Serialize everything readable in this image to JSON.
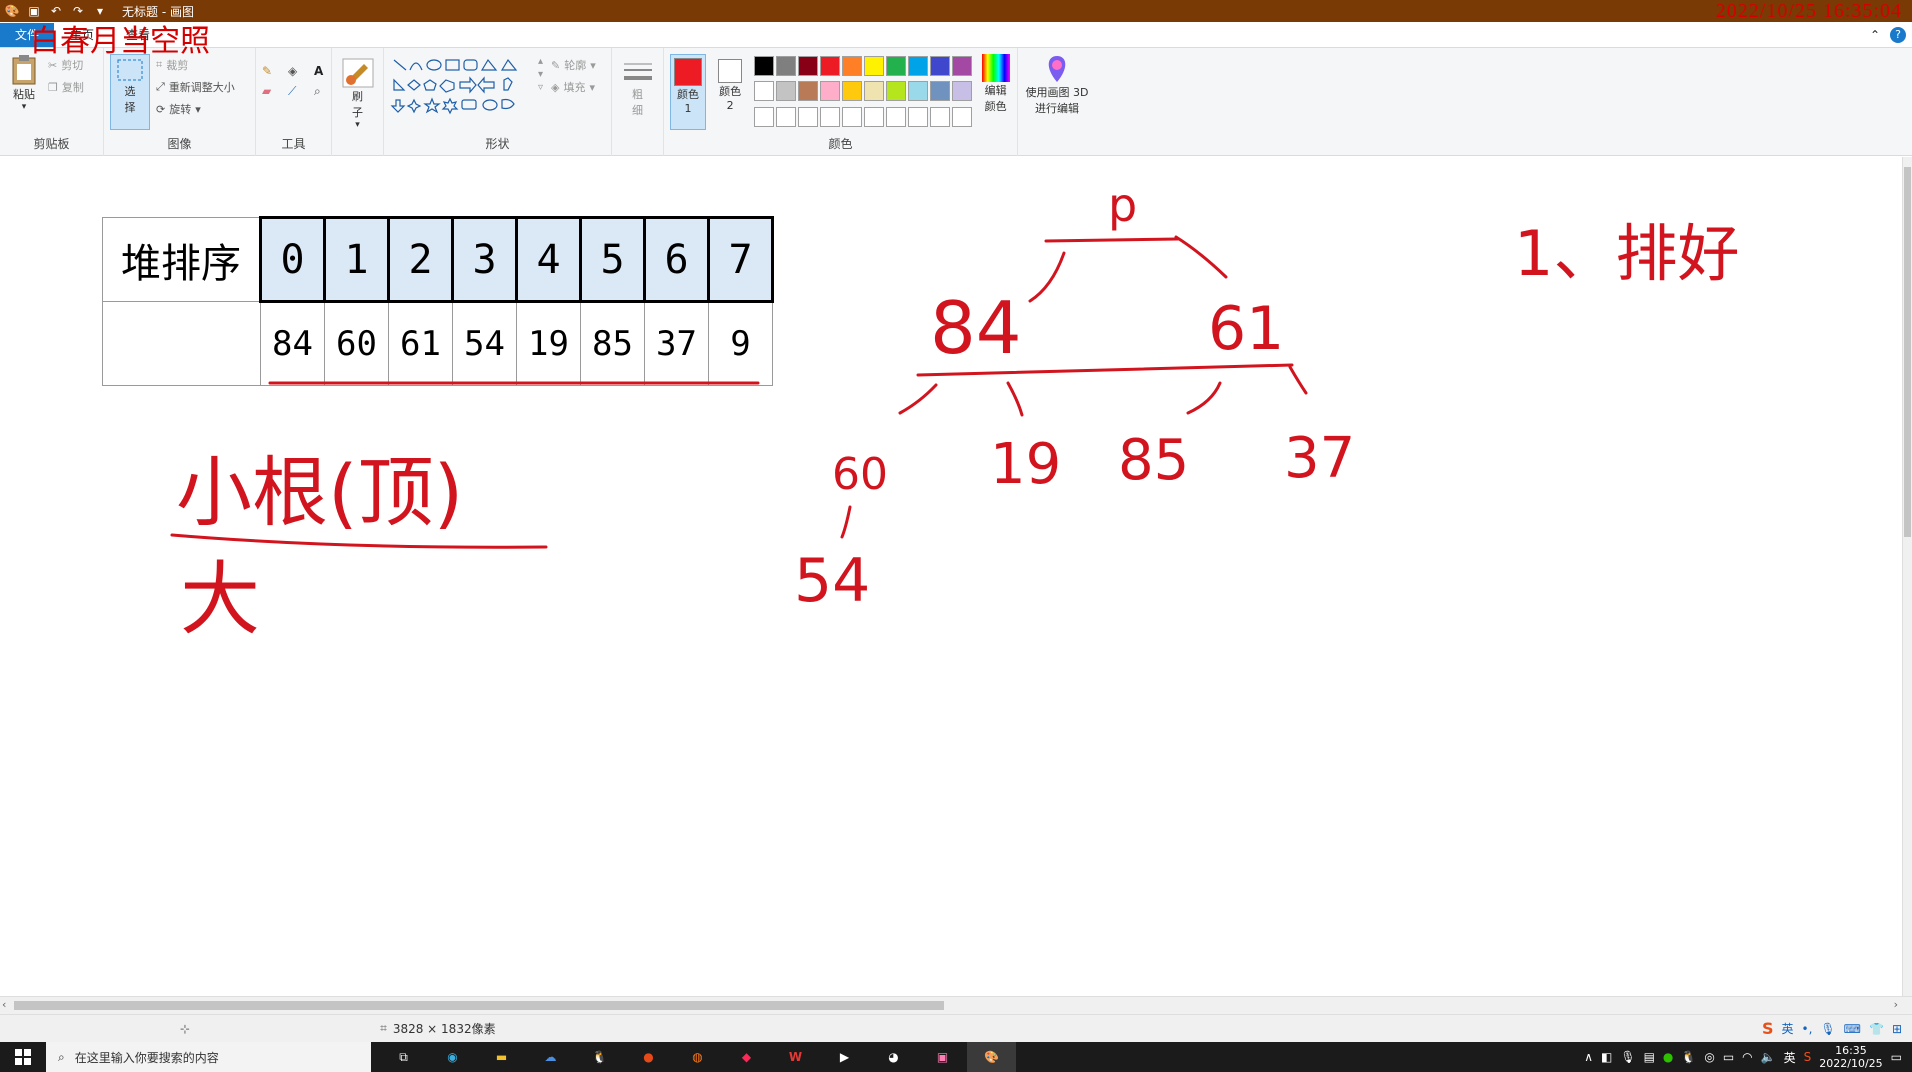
{
  "window": {
    "title": "无标题 - 画图",
    "watermark": "白春月当空照",
    "timestamp_overlay": "2022/10/25 16:35:04"
  },
  "tabs": {
    "file": "文件",
    "home": "主页",
    "view": "查看"
  },
  "ribbon": {
    "clipboard": {
      "paste": "粘贴",
      "cut": "剪切",
      "copy": "复制",
      "group": "剪贴板"
    },
    "image": {
      "select": "选择",
      "crop": "裁剪",
      "resize": "重新调整大小",
      "rotate": "旋转",
      "group": "图像"
    },
    "tools": {
      "group": "工具"
    },
    "brushes": {
      "label": "刷子"
    },
    "shapes": {
      "outline": "轮廓",
      "fill": "填充",
      "group": "形状"
    },
    "size": {
      "label": "粗细"
    },
    "colors": {
      "color1": "颜色 1",
      "color2": "颜色 2",
      "edit": "编辑颜色",
      "paint3d": "使用画图 3D 进行编辑",
      "group": "颜色",
      "color1_value": "#ed1c24",
      "color2_value": "#ffffff",
      "palette": [
        "#000000",
        "#7f7f7f",
        "#880015",
        "#ed1c24",
        "#ff7f27",
        "#fff200",
        "#22b14c",
        "#00a2e8",
        "#3f48cc",
        "#a349a4",
        "#ffffff",
        "#c3c3c3",
        "#b97a57",
        "#ffaec9",
        "#ffc90e",
        "#efe4b0",
        "#b5e61d",
        "#99d9ea",
        "#7092be",
        "#c8bfe7",
        "#ffffff",
        "#ffffff",
        "#ffffff",
        "#ffffff",
        "#ffffff",
        "#ffffff",
        "#ffffff",
        "#ffffff",
        "#ffffff",
        "#ffffff"
      ]
    }
  },
  "canvas": {
    "table": {
      "label": "堆排序",
      "indices": [
        "0",
        "1",
        "2",
        "3",
        "4",
        "5",
        "6",
        "7"
      ],
      "values": [
        "84",
        "60",
        "61",
        "54",
        "19",
        "85",
        "37",
        "9"
      ]
    },
    "annotations": {
      "small_root": "小根(顶)",
      "big": "大",
      "step_note": "1、排好",
      "tree_top": "p",
      "tree_level1": [
        "84",
        "61"
      ],
      "tree_level2": [
        "60",
        "19",
        "85",
        "37"
      ],
      "tree_level3": [
        "54"
      ]
    }
  },
  "statusbar": {
    "dimensions": "3828 × 1832像素"
  },
  "taskbar": {
    "search_placeholder": "在这里输入你要搜索的内容",
    "time": "16:35",
    "date": "2022/10/25",
    "ime": "英"
  }
}
